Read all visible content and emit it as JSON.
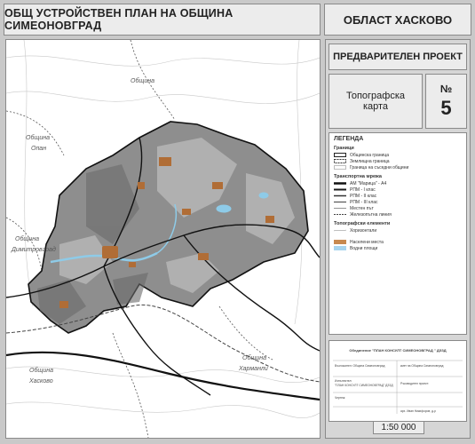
{
  "header": {
    "title": "ОБЩ УСТРОЙСТВЕН ПЛАН НА ОБЩИНА СИМЕОНОВГРАД",
    "region": "ОБЛАСТ ХАСКОВО"
  },
  "panel": {
    "stage": "ПРЕДВАРИТЕЛЕН ПРОЕКТ",
    "sheet_title_line1": "Топографска",
    "sheet_title_line2": "карта",
    "number_label": "№",
    "number_value": "5",
    "scale": "1:50 000"
  },
  "legend": {
    "title": "ЛЕГЕНДА",
    "sections": [
      {
        "heading": "Граници",
        "items": [
          {
            "label": "Общинска граница",
            "style": "municipal-boundary",
            "color": "#222222"
          },
          {
            "label": "Землищна граница",
            "style": "cadastral-boundary",
            "color": "#333333"
          },
          {
            "label": "Граница на съседни общини",
            "style": "neighbour-boundary",
            "color": "#555555"
          }
        ]
      },
      {
        "heading": "Транспортна мрежа",
        "items": [
          {
            "label": "АМ \"Марица\" - А4",
            "style": "motorway",
            "color": "#111111"
          },
          {
            "label": "РПМ - I клас",
            "style": "road-1",
            "color": "#1a1a1a"
          },
          {
            "label": "РПМ - II клас",
            "style": "road-2",
            "color": "#333333"
          },
          {
            "label": "РПМ - III клас",
            "style": "road-3",
            "color": "#444444"
          },
          {
            "label": "Местен път",
            "style": "local-road",
            "color": "#666666"
          },
          {
            "label": "Железопътна линия",
            "style": "railway",
            "color": "#444444"
          }
        ]
      },
      {
        "heading": "Топографски елементи",
        "items": [
          {
            "label": "Хоризонтали",
            "style": "contours",
            "color": "#999999"
          },
          {
            "label": "Населени места",
            "style": "settlements",
            "color": "#c8894f"
          },
          {
            "label": "Водни площи",
            "style": "water",
            "color": "#a8d4ee"
          }
        ]
      }
    ]
  },
  "stamp": {
    "firm": "Обединение \"ПЛАН КОНСУЛТ СИМЕОНОВГРАД \" ДЗЗД",
    "row1_left": "Възложител: Община Симеоновград",
    "row1_right": "кмет на Община Симеоновград",
    "row2_left": "Изпълнител:",
    "row2_left2": "\"ПЛАН КОНСУЛТ СИМЕОНОВГРАД\" ДЗЗД",
    "row2_right": "Ръководител проект:",
    "row3_left": "Чертеж:",
    "row3_right": "арх. Иван Никифоров, д-р"
  },
  "map": {
    "labels": [
      {
        "text": "Община"
      },
      {
        "text": "Община"
      },
      {
        "text": "Опан"
      },
      {
        "text": "Община"
      },
      {
        "text": "Димитровград"
      },
      {
        "text": "Община"
      },
      {
        "text": "Харманли"
      },
      {
        "text": "Община"
      },
      {
        "text": "Хасково"
      }
    ],
    "colors": {
      "municipality_fill": "#8e8e8e",
      "settlement": "#b06d36",
      "water": "#8ecbe8",
      "road": "#111111"
    }
  }
}
